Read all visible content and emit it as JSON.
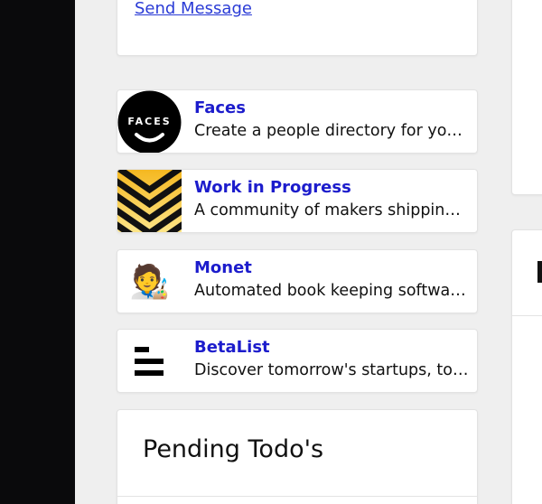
{
  "message_card": {
    "send_message_link": "Send Message"
  },
  "products": [
    {
      "name": "Faces",
      "description": "Create a people directory for your company in minutes",
      "logo": "faces-logo",
      "logo_text": "FACES"
    },
    {
      "name": "Work in Progress",
      "description": "A community of makers shipping together",
      "logo": "chevron-stripes-logo"
    },
    {
      "name": "Monet",
      "description": "Automated book keeping software for freelancers",
      "logo": "artist-emoji-logo",
      "logo_text": "🧑‍🎨"
    },
    {
      "name": "BetaList",
      "description": "Discover tomorrow's startups, today",
      "logo": "betalist-bars-logo"
    }
  ],
  "todo": {
    "title": "Pending Todo's"
  },
  "colors": {
    "sidebar": "#0a0a0c",
    "background": "#efefef",
    "link": "#2a3bd6",
    "product_name": "#1c1ccc",
    "stripe_yellow": "#f7c331"
  }
}
